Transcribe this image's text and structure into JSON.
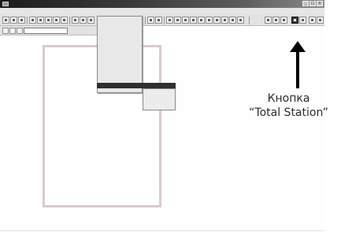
{
  "window": {
    "title": "",
    "controls": [
      "_",
      "□",
      "x"
    ]
  },
  "menubar": {
    "items": []
  },
  "toolbar": {
    "icon_count": 34,
    "station_icon": "total-station-icon",
    "combo_value": ""
  },
  "dropdown": {
    "items": []
  },
  "submenu": {
    "items": []
  },
  "annotation": {
    "line1": "Кнопка",
    "line2": "“Total Station”"
  },
  "colors": {
    "frame_border": "#dccaca",
    "titlebar_start": "#1c1c1c",
    "highlight": "#2f2f2f",
    "arrow": "#000000"
  }
}
